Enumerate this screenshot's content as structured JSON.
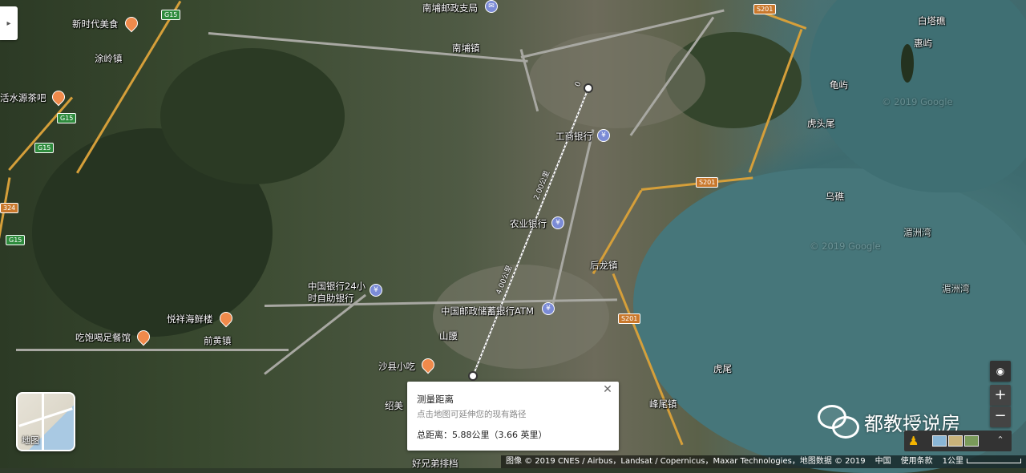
{
  "map": {
    "places": [
      {
        "id": "nanbu-post",
        "label": "南埔邮政支局"
      },
      {
        "id": "xinshidai",
        "label": "新时代美食"
      },
      {
        "id": "tuling",
        "label": "涂岭镇"
      },
      {
        "id": "huoshuiyuan",
        "label": "活水源茶吧"
      },
      {
        "id": "nanbu-town",
        "label": "南埔镇"
      },
      {
        "id": "icbc",
        "label": "工商银行"
      },
      {
        "id": "abc",
        "label": "农业银行"
      },
      {
        "id": "boc",
        "label": "中国银行24小时自助银行"
      },
      {
        "id": "postal-atm",
        "label": "中国邮政储蓄银行ATM"
      },
      {
        "id": "yuexiang",
        "label": "悦祥海鲜楼"
      },
      {
        "id": "chifan",
        "label": "吃饱喝足餐馆"
      },
      {
        "id": "qianhuang",
        "label": "前黄镇"
      },
      {
        "id": "shanyao",
        "label": "山腰"
      },
      {
        "id": "shaxian",
        "label": "沙县小吃"
      },
      {
        "id": "shaomei",
        "label": "绍美"
      },
      {
        "id": "houlong",
        "label": "后龙镇"
      },
      {
        "id": "baitajiao",
        "label": "白塔礁"
      },
      {
        "id": "huiyu",
        "label": "惠屿"
      },
      {
        "id": "guiyu",
        "label": "龟屿"
      },
      {
        "id": "hutouwei",
        "label": "虎头尾"
      },
      {
        "id": "wujiao",
        "label": "乌礁"
      },
      {
        "id": "louzhouwan1",
        "label": "湄洲湾"
      },
      {
        "id": "louzhouwan2",
        "label": "湄洲湾"
      },
      {
        "id": "huwei",
        "label": "虎尾"
      },
      {
        "id": "fengwei",
        "label": "峰尾镇"
      },
      {
        "id": "haoxiongdi",
        "label": "好兄弟排档"
      }
    ],
    "shields": {
      "g15": "G15",
      "s201": "S201",
      "g324": "324"
    },
    "measure_labels": {
      "d0": "0",
      "d2": "2.00公里",
      "d4": "4.00公里",
      "d6": "5.88公里"
    },
    "watermark_1": "© 2019 Google",
    "watermark_2": "© 2019 Google"
  },
  "controls": {
    "layer_label": "地图",
    "zoom_in": "+",
    "zoom_out": "−",
    "compass": "◉",
    "expand": "⌃",
    "sidebar_toggle": "▸"
  },
  "measure_card": {
    "title": "测量距离",
    "hint": "点击地图可延伸您的现有路径",
    "total": "总距离：5.88公里（3.66 英里）",
    "close": "✕"
  },
  "watermark_brand": "都教授说房",
  "attribution": {
    "imagery": "图像 © 2019 CNES / Airbus，Landsat / Copernicus，Maxar Technologies，地图数据 © 2019",
    "region": "中国",
    "terms": "使用条款",
    "scale": "1公里"
  },
  "colors": {
    "highway": "#d59f3a",
    "road": "#a8a8a2",
    "sea": "#46767a",
    "poi_pin": "#f08a4b",
    "bank_pin": "#7b8bd6"
  }
}
